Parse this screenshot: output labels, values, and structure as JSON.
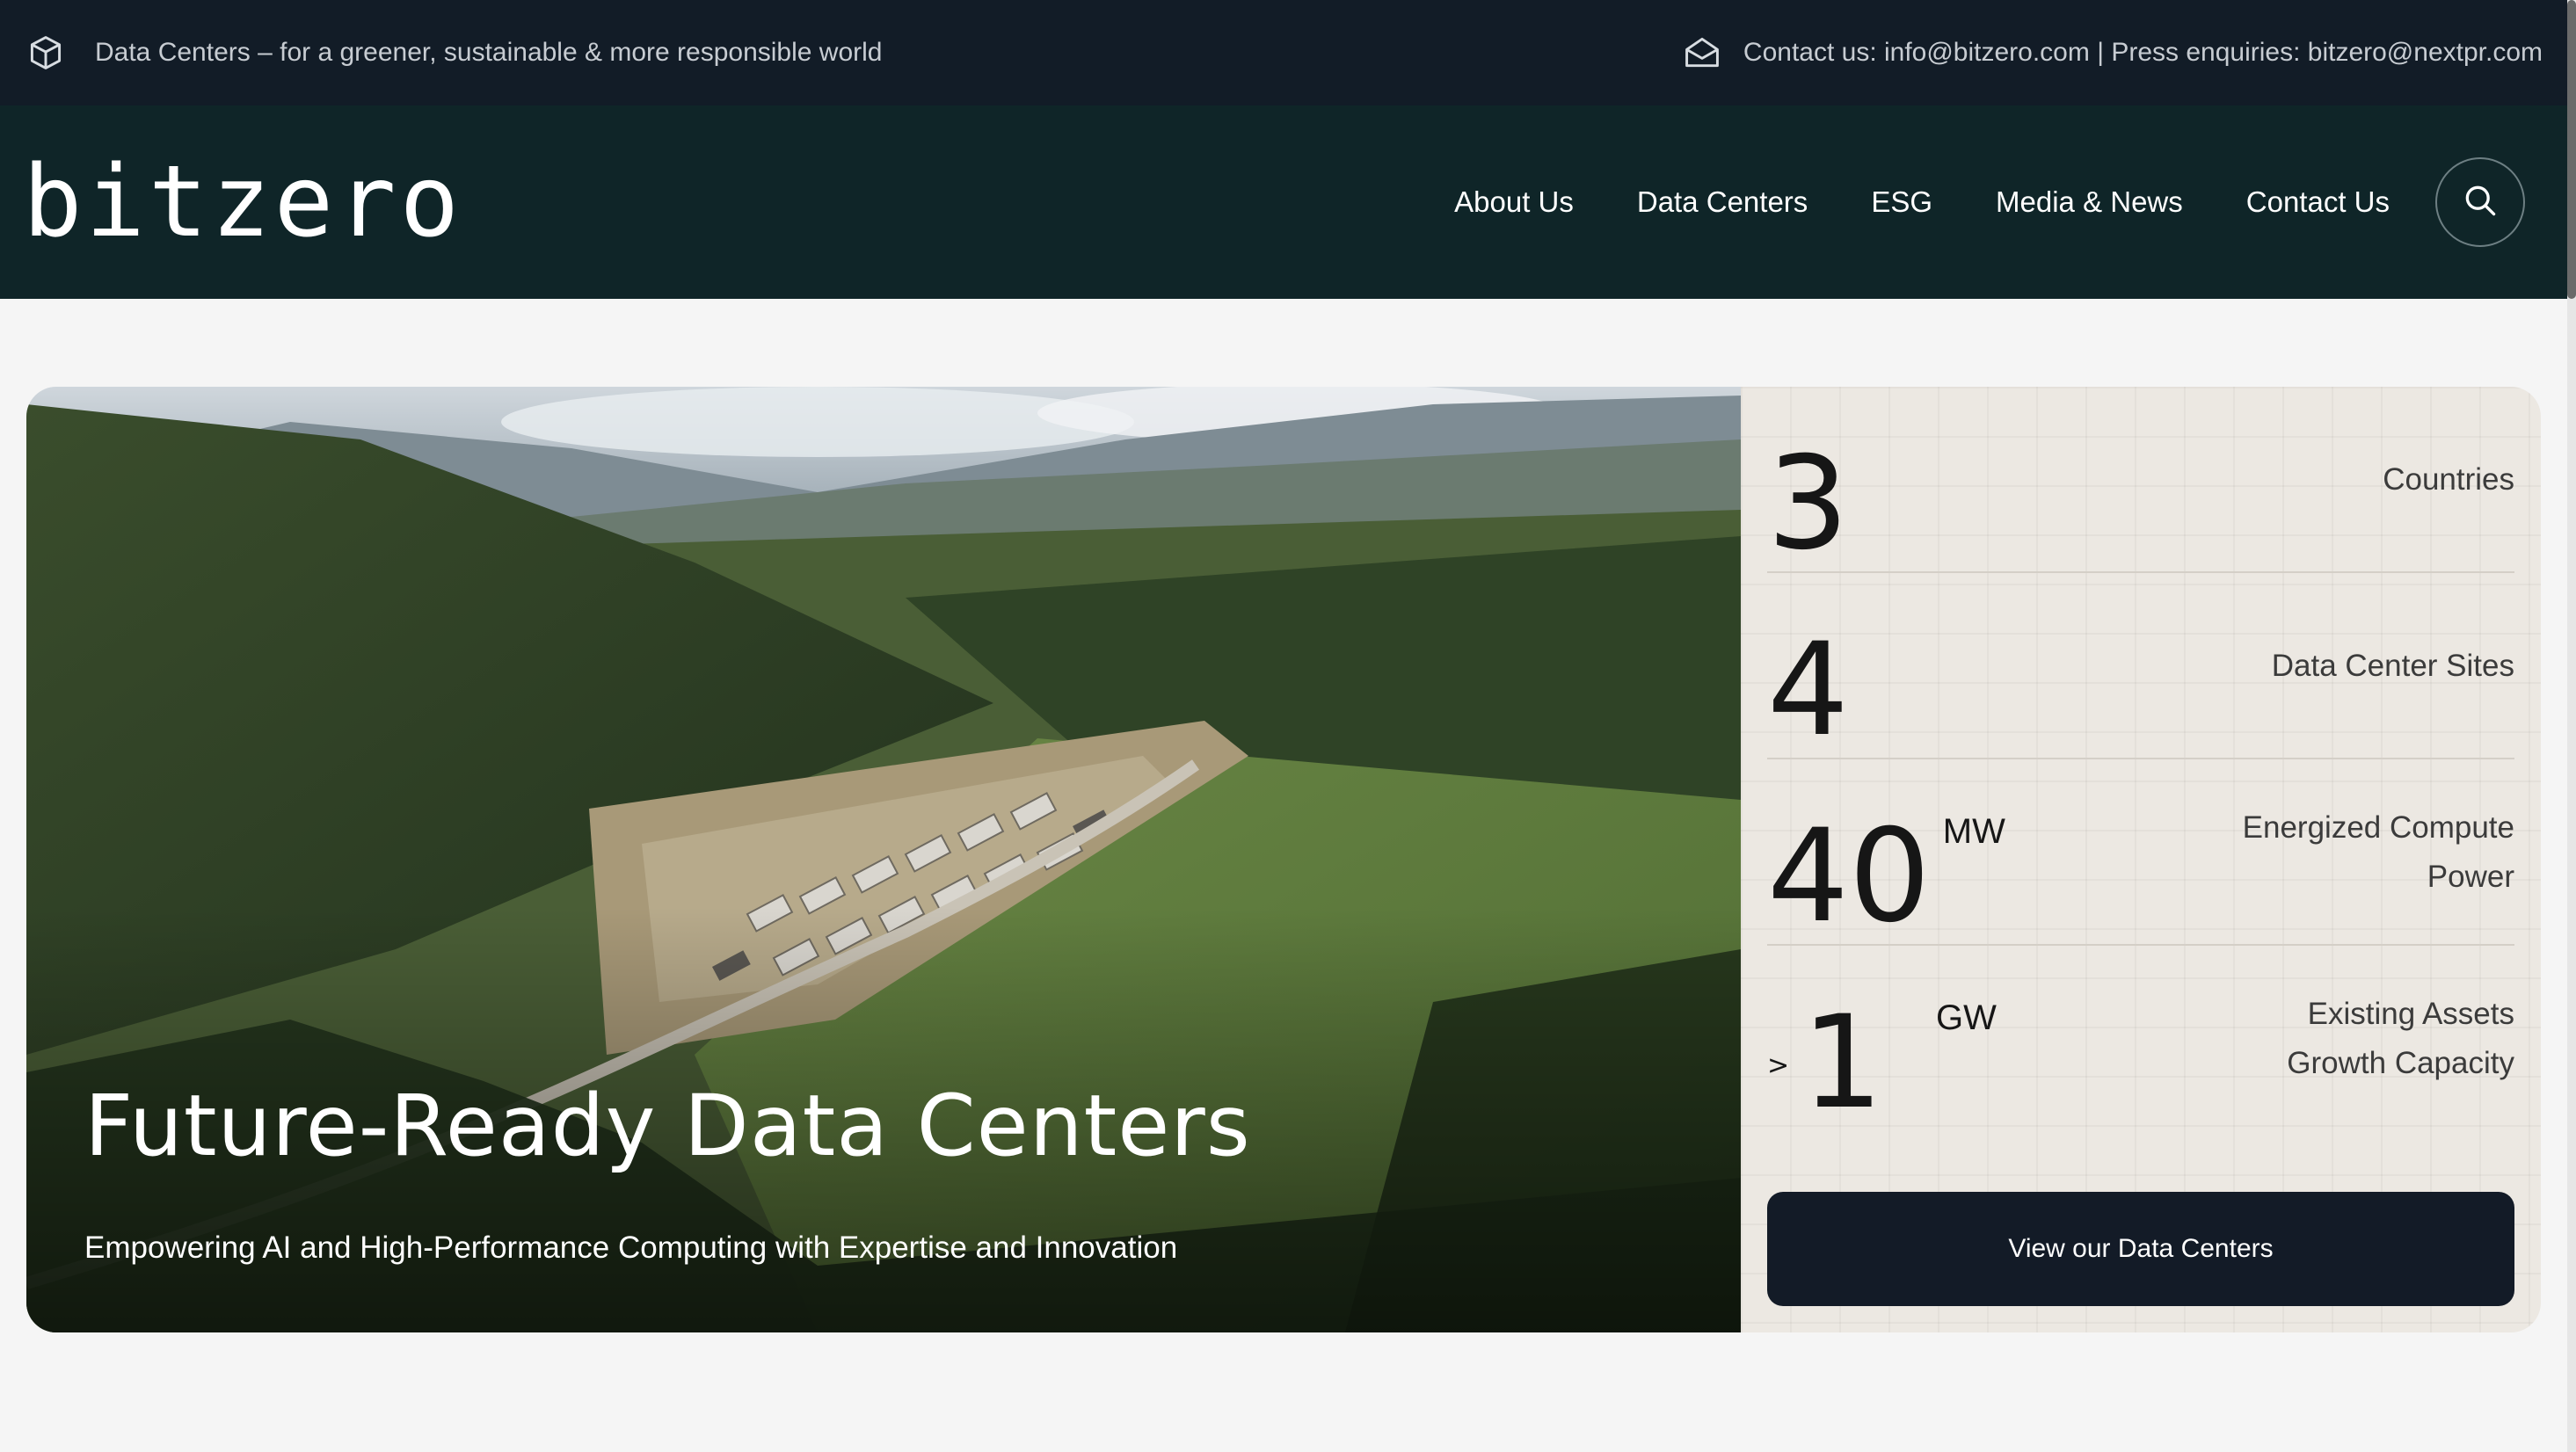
{
  "topbar": {
    "tagline": "Data Centers – for a greener, sustainable & more responsible world",
    "contact": "Contact us: info@bitzero.com | Press enquiries: bitzero@nextpr.com",
    "left_icon": "cube-icon",
    "right_icon": "envelope-icon"
  },
  "nav": {
    "logo": "bitzero",
    "items": [
      "About Us",
      "Data Centers",
      "ESG",
      "Media & News",
      "Contact Us"
    ],
    "search_icon": "search-icon"
  },
  "hero": {
    "title": "Future-Ready Data Centers",
    "subtitle": "Empowering AI and High-Performance Computing with Expertise and Innovation"
  },
  "stats": [
    {
      "prefix": "",
      "value": "3",
      "unit": "",
      "label": "Countries"
    },
    {
      "prefix": "",
      "value": "4",
      "unit": "",
      "label": "Data Center Sites"
    },
    {
      "prefix": "",
      "value": "40",
      "unit": "MW",
      "label": "Energized Compute Power"
    },
    {
      "prefix": ">",
      "value": "1",
      "unit": "GW",
      "label": "Existing Assets Growth Capacity"
    }
  ],
  "cta": {
    "label": "View our Data Centers"
  },
  "colors": {
    "topbar_bg": "#121c27",
    "nav_bg": "#0f2528",
    "page_bg": "#f5f5f5",
    "stats_bg": "#ece8e2",
    "cta_bg": "#131b27"
  }
}
